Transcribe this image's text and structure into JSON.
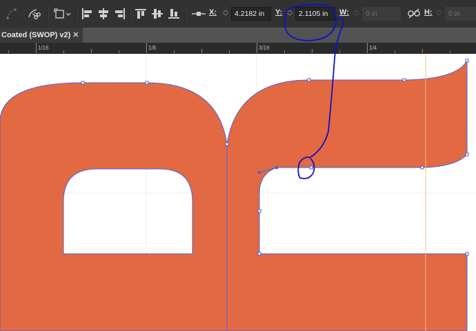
{
  "toolbar": {
    "x_label": "X:",
    "x_value": "4.2182 in",
    "y_label": "Y:",
    "y_value": "2.1105 in",
    "w_label": "W:",
    "w_value": "0 in",
    "h_label": "H:",
    "h_value": "0 in"
  },
  "document_tab": {
    "title": "Coated (SWOP) v2)",
    "close_glyph": "✕"
  },
  "ruler": {
    "labels": [
      "1/16",
      "1/8",
      "3/16",
      "1/4"
    ]
  },
  "colors": {
    "artwork_fill": "#e36943",
    "path_selection": "#4a62d8",
    "annotation_ink": "#1010c8",
    "guide": "#f5c07a"
  }
}
